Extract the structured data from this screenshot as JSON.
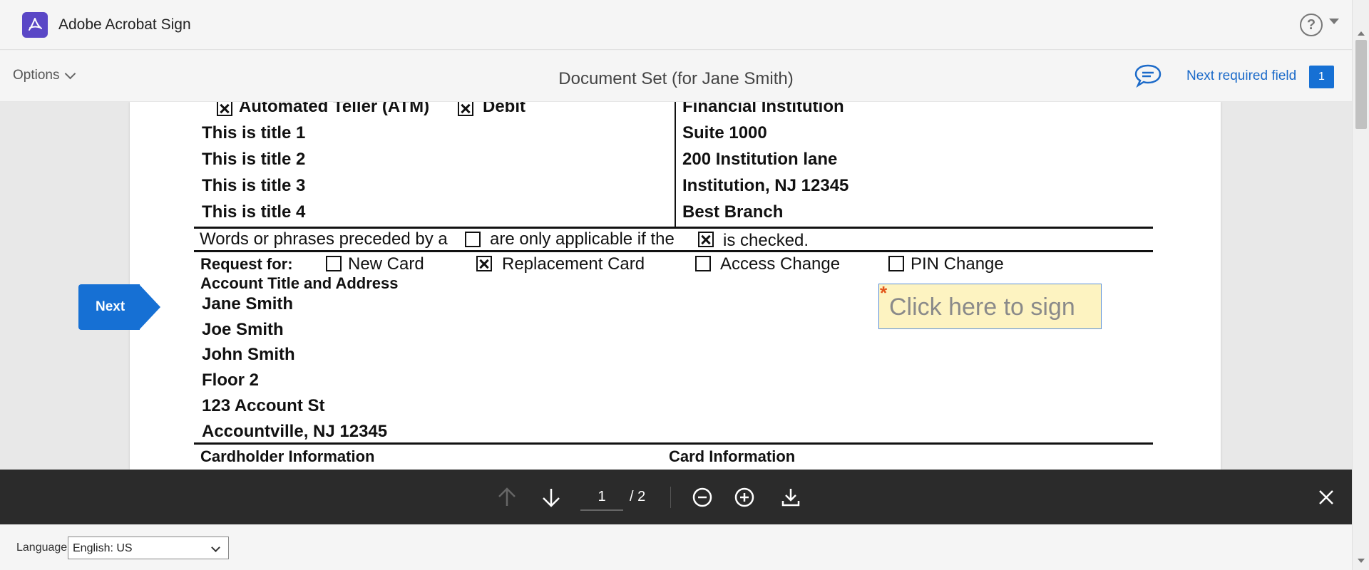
{
  "app": {
    "title": "Adobe Acrobat Sign"
  },
  "subbar": {
    "options_label": "Options",
    "document_title": "Document Set (for Jane Smith)",
    "next_required_label": "Next required field",
    "required_count": "1"
  },
  "document": {
    "top_left_checks": [
      "Automated Teller (ATM)",
      "Debit"
    ],
    "titles": [
      "This is title 1",
      "This is title 2",
      "This is title 3",
      "This is title 4"
    ],
    "institution": [
      "Financial Institution",
      "Suite 1000",
      "200 Institution lane",
      "Institution, NJ 12345",
      "Best Branch"
    ],
    "notice_prefix": "Words or phrases preceded by a",
    "notice_middle": "are only applicable if the",
    "notice_suffix": "is checked.",
    "request_label": "Request for:",
    "request_options": [
      {
        "label": "New Card",
        "checked": false
      },
      {
        "label": "Replacement Card",
        "checked": true
      },
      {
        "label": "Access Change",
        "checked": false
      },
      {
        "label": "PIN Change",
        "checked": false
      }
    ],
    "account_heading": "Account Title and Address",
    "account_lines": [
      "Jane Smith",
      "Joe Smith",
      "John Smith",
      "Floor 2",
      "123 Account St",
      "Accountville, NJ 12345"
    ],
    "cardholder_heading": "Cardholder Information",
    "card_heading": "Card Information",
    "sign_placeholder": "Click here to sign"
  },
  "next_button": {
    "label": "Next"
  },
  "toolbar": {
    "current_page": "1",
    "total_pages": "/ 2"
  },
  "footer": {
    "language_label": "Language",
    "language_value": "English: US"
  },
  "colors": {
    "accent": "#1670d4",
    "brand": "#5a47c6",
    "sign_field_bg": "#fdf3c1",
    "toolbar_bg": "#2b2b2b"
  }
}
